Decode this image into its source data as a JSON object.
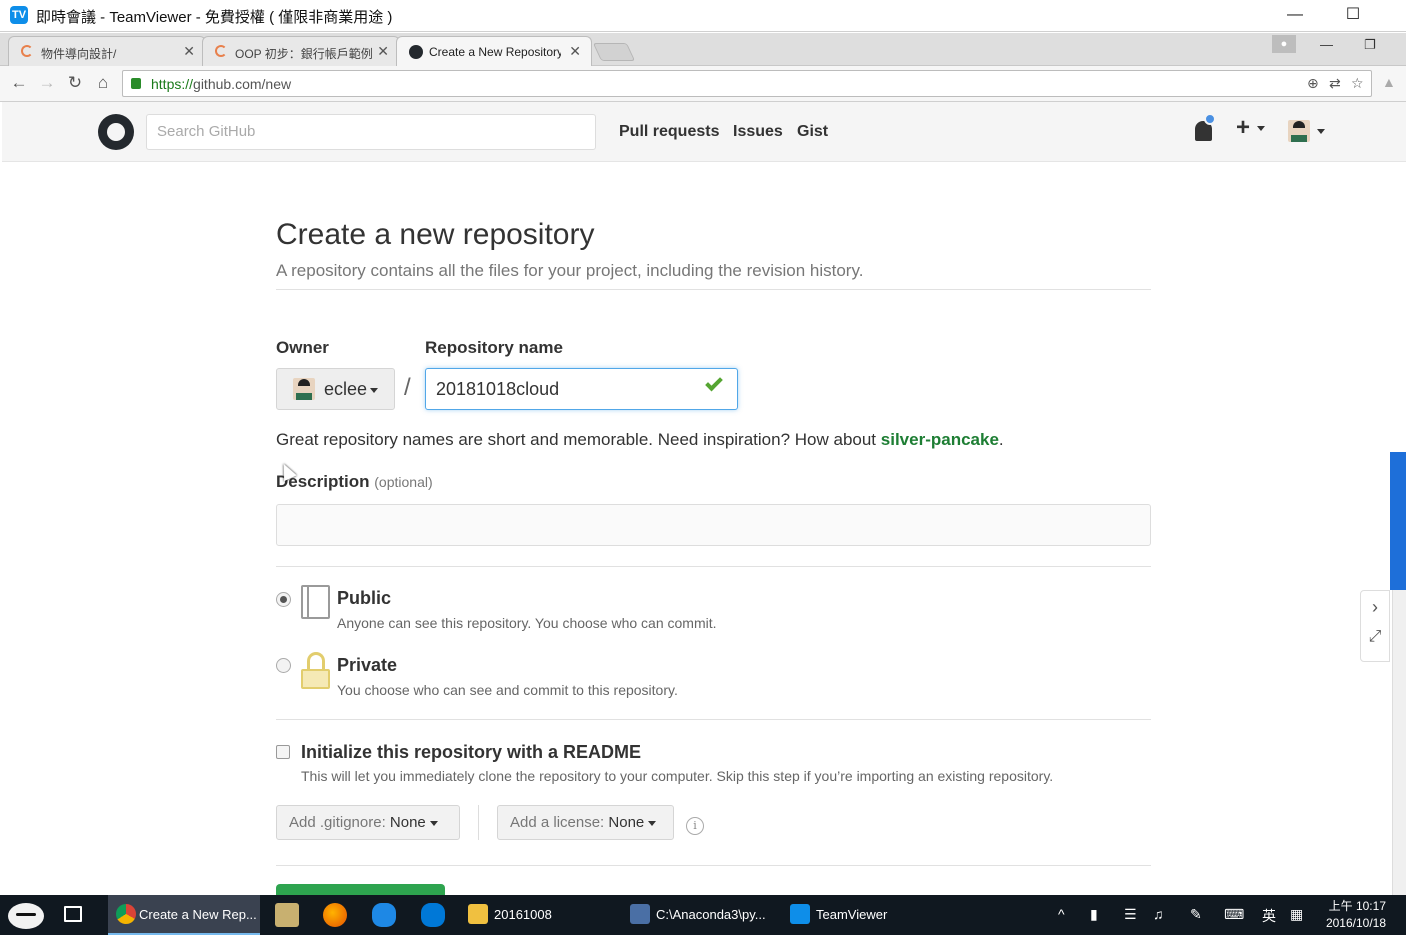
{
  "teamviewer": {
    "logo": "TV",
    "title": "即時會議 - TeamViewer - 免費授權 ( 僅限非商業用途 )",
    "minimize_glyph": "—",
    "maximize_glyph": "☐"
  },
  "browser": {
    "tabs": [
      {
        "label": "物件導向設計/",
        "close": "✕"
      },
      {
        "label": "OOP 初步：銀行帳戶範例",
        "close": "✕"
      },
      {
        "label": "Create a New Repository",
        "close": "✕"
      }
    ],
    "nav": {
      "back": "←",
      "forward": "→",
      "reload": "↻",
      "home": "⌂"
    },
    "url_scheme": "https://",
    "url_host": "github.com",
    "url_path": "/new",
    "omnibox_icons": {
      "zoom": "⊕",
      "translate": "⇄",
      "star": "☆"
    }
  },
  "github_header": {
    "search_placeholder": "Search GitHub",
    "nav": [
      "Pull requests",
      "Issues",
      "Gist"
    ],
    "plus": "+"
  },
  "form": {
    "title": "Create a new repository",
    "subtitle": "A repository contains all the files for your project, including the revision history.",
    "owner_label": "Owner",
    "owner_name": "eclee",
    "slash": "/",
    "repo_label": "Repository name",
    "repo_value": "20181018cloud",
    "hint_prefix": "Great repository names are short and memorable. Need inspiration? How about ",
    "hint_suggestion": "silver-pancake",
    "hint_suffix": ".",
    "description_label": "Description",
    "description_optional": "(optional)",
    "visibility": {
      "public_title": "Public",
      "public_desc": "Anyone can see this repository. You choose who can commit.",
      "private_title": "Private",
      "private_desc": "You choose who can see and commit to this repository.",
      "selected": "public"
    },
    "readme_title": "Initialize this repository with a README",
    "readme_desc": "This will let you immediately clone the repository to your computer. Skip this step if you’re importing an existing repository.",
    "gitignore_label": "Add .gitignore:",
    "gitignore_value": "None",
    "license_label": "Add a license:",
    "license_value": "None",
    "info_glyph": "i"
  },
  "side_controls": {
    "expand": "›",
    "fullscreen": "⤢"
  },
  "taskbar": {
    "items": [
      {
        "label": "Create a New Rep..."
      },
      {
        "label": "20161008"
      },
      {
        "label": "C:\\Anaconda3\\py..."
      },
      {
        "label": "TeamViewer"
      }
    ],
    "tray": {
      "chevron": "^",
      "ime": "英"
    },
    "clock_time": "上午 10:17",
    "clock_date": "2016/10/18"
  },
  "colors": {
    "accent_blue": "#51a7e8",
    "success_green": "#55a532",
    "suggestion_green": "#1e7e34",
    "create_button_green": "#2ea44f",
    "teamviewer_blue": "#0e8ee9"
  }
}
